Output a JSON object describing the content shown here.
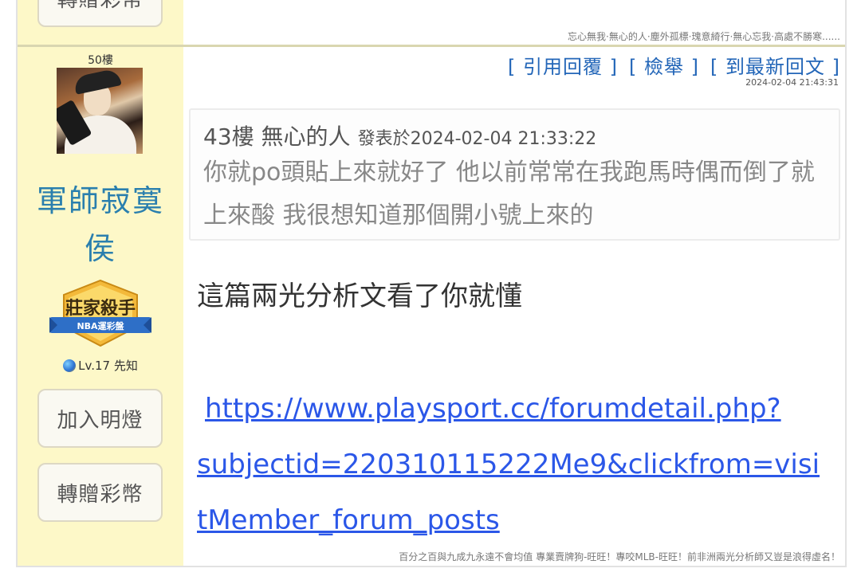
{
  "previous_post": {
    "gift_button_label": "轉贈彩幣",
    "signature": "忘心無我·無心的人·塵外孤標·瑰意綺行·無心忘我·高處不勝寒......"
  },
  "post": {
    "floor": "50樓",
    "author": {
      "name": "軍師寂寞侯",
      "name_line1": "軍師寂寞",
      "name_line2": "侯",
      "badge_title": "莊家殺手",
      "badge_subtitle": "NBA運彩盤",
      "level": "Lv.17 先知"
    },
    "sidebar_buttons": {
      "follow_label": "加入明燈",
      "gift_label": "轉贈彩幣"
    },
    "actions": {
      "reply_quote": "[ 引用回覆 ]",
      "report": "[ 檢舉 ]",
      "latest": "[ 到最新回文 ]"
    },
    "timestamp": "2024-02-04 21:43:31",
    "quote": {
      "floor_author": "43樓 無心的人",
      "posted_at": "發表於2024-02-04 21:33:22",
      "text": "你就po頭貼上來就好了 他以前常常在我跑馬時偶而倒了就上來酸 我很想知道那個開小號上來的"
    },
    "body_text": "這篇兩光分析文看了你就懂",
    "link": {
      "line1": "https://www.playsport.cc/forumdetail.php?",
      "line2": "subjectid=220310115222Me9&clickfrom=visi",
      "line3": "tMember_forum_posts"
    },
    "signature": "百分之百與九成九永遠不會均值 專業賣牌狗-旺旺！專咬MLB-旺旺！前非洲兩光分析師又豈是浪得虛名！"
  },
  "colors": {
    "sidebar_bg": "#fdf8c8",
    "username": "#2a7fae",
    "action_link": "#2366b8",
    "post_link": "#2b57e8"
  }
}
